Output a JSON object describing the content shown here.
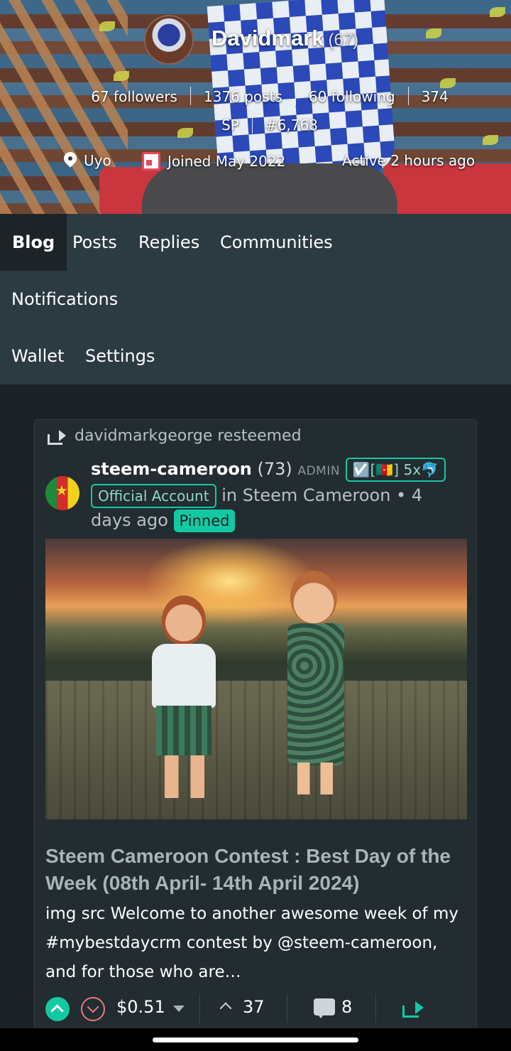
{
  "profile": {
    "name": "Davidmark",
    "reputation": "(67)",
    "followers": "67 followers",
    "posts": "1376 posts",
    "following": "60 following",
    "sp_value": "374",
    "sp_label": "SP",
    "rank": "#6,768",
    "location": "Uyo",
    "joined": "Joined May 2022",
    "active": "Active 2 hours ago"
  },
  "nav": {
    "blog": "Blog",
    "posts": "Posts",
    "replies": "Replies",
    "communities": "Communities",
    "notifications": "Notifications",
    "wallet": "Wallet",
    "settings": "Settings"
  },
  "post": {
    "resteemed_by": "davidmarkgeorge resteemed",
    "author": "steem-cameroon",
    "author_rep": "(73)",
    "role": "ADMIN",
    "badge": "☑️[🇨🇲] 5x🐬",
    "title_badge": "Official Account",
    "community_text": "in Steem Cameroon • 4 days ago",
    "pinned": "Pinned",
    "title": "Steem Cameroon Contest : Best Day of the Week (08th April- 14th April 2024)",
    "excerpt": "img src Welcome to another awesome week of my #mybestdaycrm contest by @steem-cameroon, and for those who are…",
    "payout": "$0.51",
    "votes": "37",
    "comments": "8"
  },
  "colors": {
    "accent": "#13c9a4",
    "nav_bg": "#2c3a42",
    "page_bg": "#1c2327",
    "card_bg": "#232c30",
    "downvote": "#e57a7a"
  },
  "icons": [
    "map-pin-icon",
    "calendar-icon",
    "resteem-icon",
    "upvote-icon",
    "downvote-icon",
    "caret-down-icon",
    "votes-icon",
    "comment-icon",
    "reblog-icon"
  ]
}
